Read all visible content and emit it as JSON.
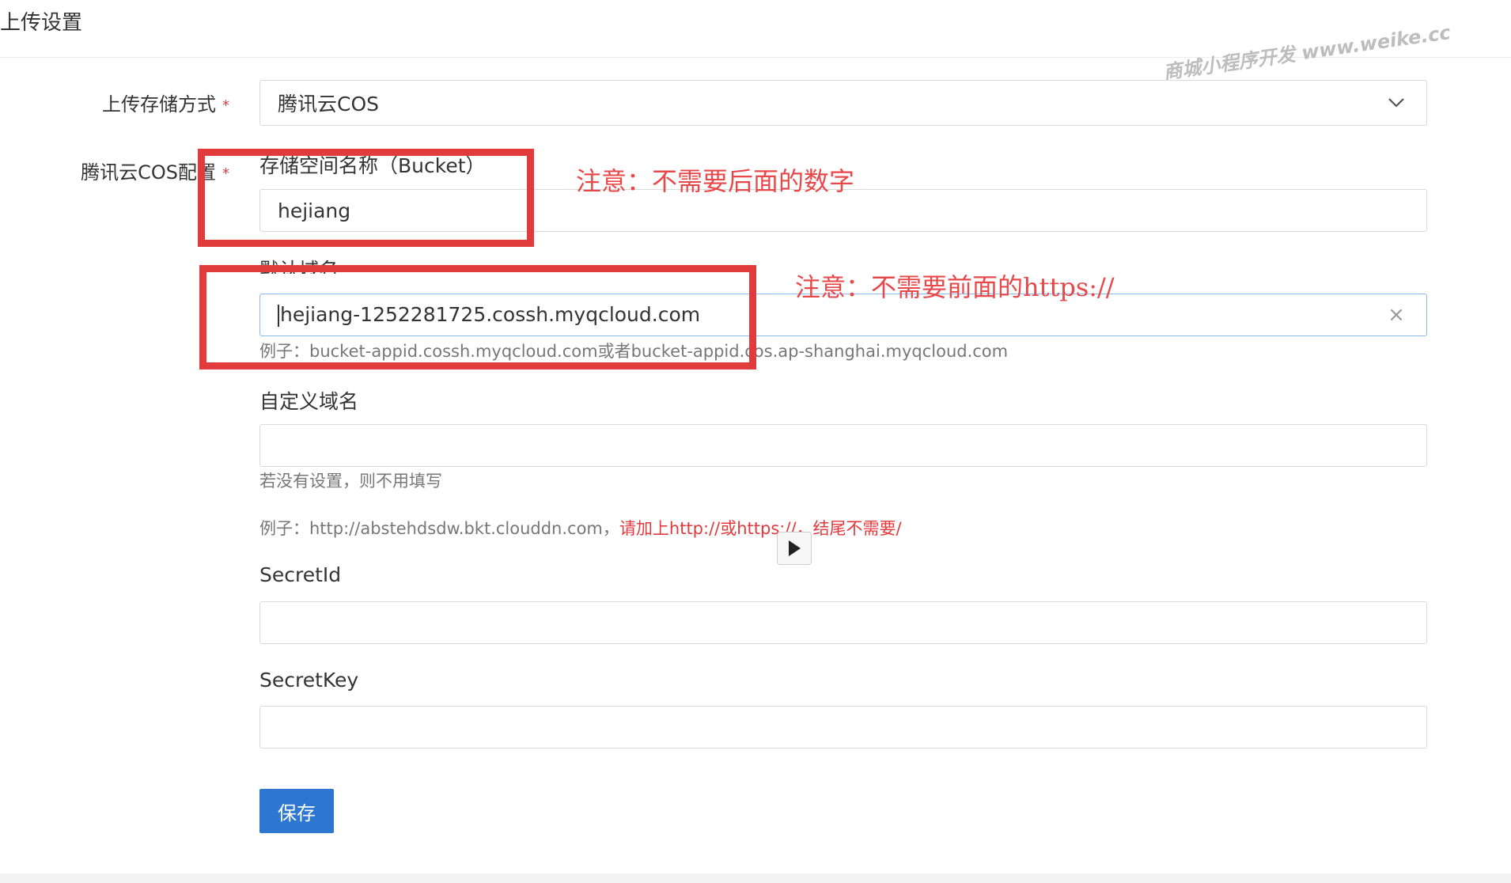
{
  "page": {
    "title": "上传设置"
  },
  "watermark": {
    "text": "商城小程序开发 www.weike.cc"
  },
  "form": {
    "storage_method": {
      "label": "上传存储方式",
      "required_mark": "*",
      "value": "腾讯云COS"
    },
    "cos_config": {
      "label": "腾讯云COS配置",
      "required_mark": "*",
      "bucket": {
        "label": "存储空间名称（Bucket）",
        "value": "hejiang"
      },
      "default_domain": {
        "label": "默认域名",
        "value": "hejiang-1252281725.cossh.myqcloud.com",
        "help": "例子：bucket-appid.cossh.myqcloud.com或者bucket-appid.cos.ap-shanghai.myqcloud.com"
      },
      "custom_domain": {
        "label": "自定义域名",
        "value": "",
        "help_line1": "若没有设置，则不用填写",
        "help_line2_prefix": "例子：http://abstehdsdw.bkt.clouddn.com，",
        "help_line2_red": "请加上http://或https://，结尾不需要/"
      },
      "secret_id": {
        "label": "SecretId",
        "value": ""
      },
      "secret_key": {
        "label": "SecretKey",
        "value": ""
      }
    },
    "save_label": "保存"
  },
  "annotations": {
    "note1": "注意：不需要后面的数字",
    "note2": "注意：不需要前面的https://"
  }
}
